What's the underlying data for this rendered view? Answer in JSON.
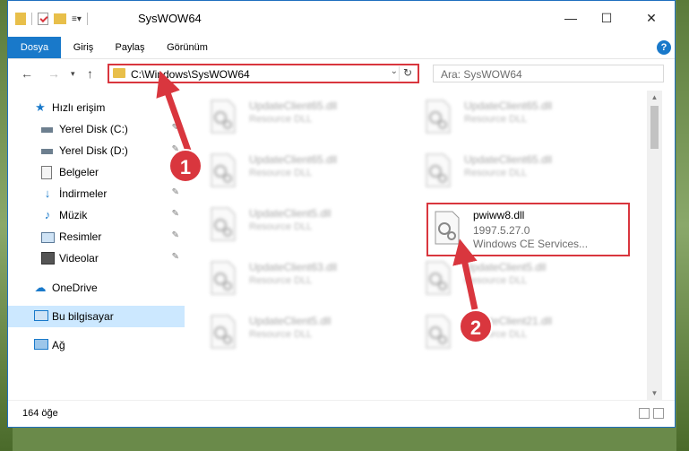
{
  "window": {
    "title": "SysWOW64",
    "minimize": "—",
    "maximize": "☐",
    "close": "✕"
  },
  "ribbon": {
    "tabs": [
      "Dosya",
      "Giriş",
      "Paylaş",
      "Görünüm"
    ],
    "help": "?"
  },
  "address": {
    "path": "C:\\Windows\\SysWOW64",
    "search_placeholder": "Ara: SysWOW64"
  },
  "sidebar": {
    "items": [
      {
        "label": "Hızlı erişim",
        "icon": "star-icon"
      },
      {
        "label": "Yerel Disk (C:)",
        "icon": "drive-icon"
      },
      {
        "label": "Yerel Disk (D:)",
        "icon": "drive-icon"
      },
      {
        "label": "Belgeler",
        "icon": "documents-icon"
      },
      {
        "label": "İndirmeler",
        "icon": "download-icon"
      },
      {
        "label": "Müzik",
        "icon": "music-icon"
      },
      {
        "label": "Resimler",
        "icon": "pictures-icon"
      },
      {
        "label": "Videolar",
        "icon": "video-icon"
      },
      {
        "label": "OneDrive",
        "icon": "cloud-icon"
      },
      {
        "label": "Bu bilgisayar",
        "icon": "computer-icon"
      },
      {
        "label": "Ağ",
        "icon": "network-icon"
      }
    ]
  },
  "files": [
    {
      "name": "UpdateClient65.dll",
      "type": "Resource DLL"
    },
    {
      "name": "UpdateClient65.dll",
      "type": "Resource DLL"
    },
    {
      "name": "UpdateClient65.dll",
      "type": "Resource DLL"
    },
    {
      "name": "UpdateClient65.dll",
      "type": "Resource DLL"
    },
    {
      "name": "UpdateClient5.dll",
      "type": "Resource DLL"
    },
    {
      "name": "UpdateClient63.dll",
      "type": "Resource DLL"
    },
    {
      "name": "UpdateClient5.dll",
      "type": "Resource DLL"
    },
    {
      "name": "UpdateClient5.dll",
      "type": "Resource DLL"
    },
    {
      "name": "UpdateClient21.dll",
      "type": "Resource DLL"
    }
  ],
  "highlighted_file": {
    "name": "pwiww8.dll",
    "version": "1997.5.27.0",
    "description": "Windows CE Services..."
  },
  "status": {
    "count": "164 öğe"
  },
  "annotations": {
    "step1": "1",
    "step2": "2",
    "color": "#d9363e"
  }
}
